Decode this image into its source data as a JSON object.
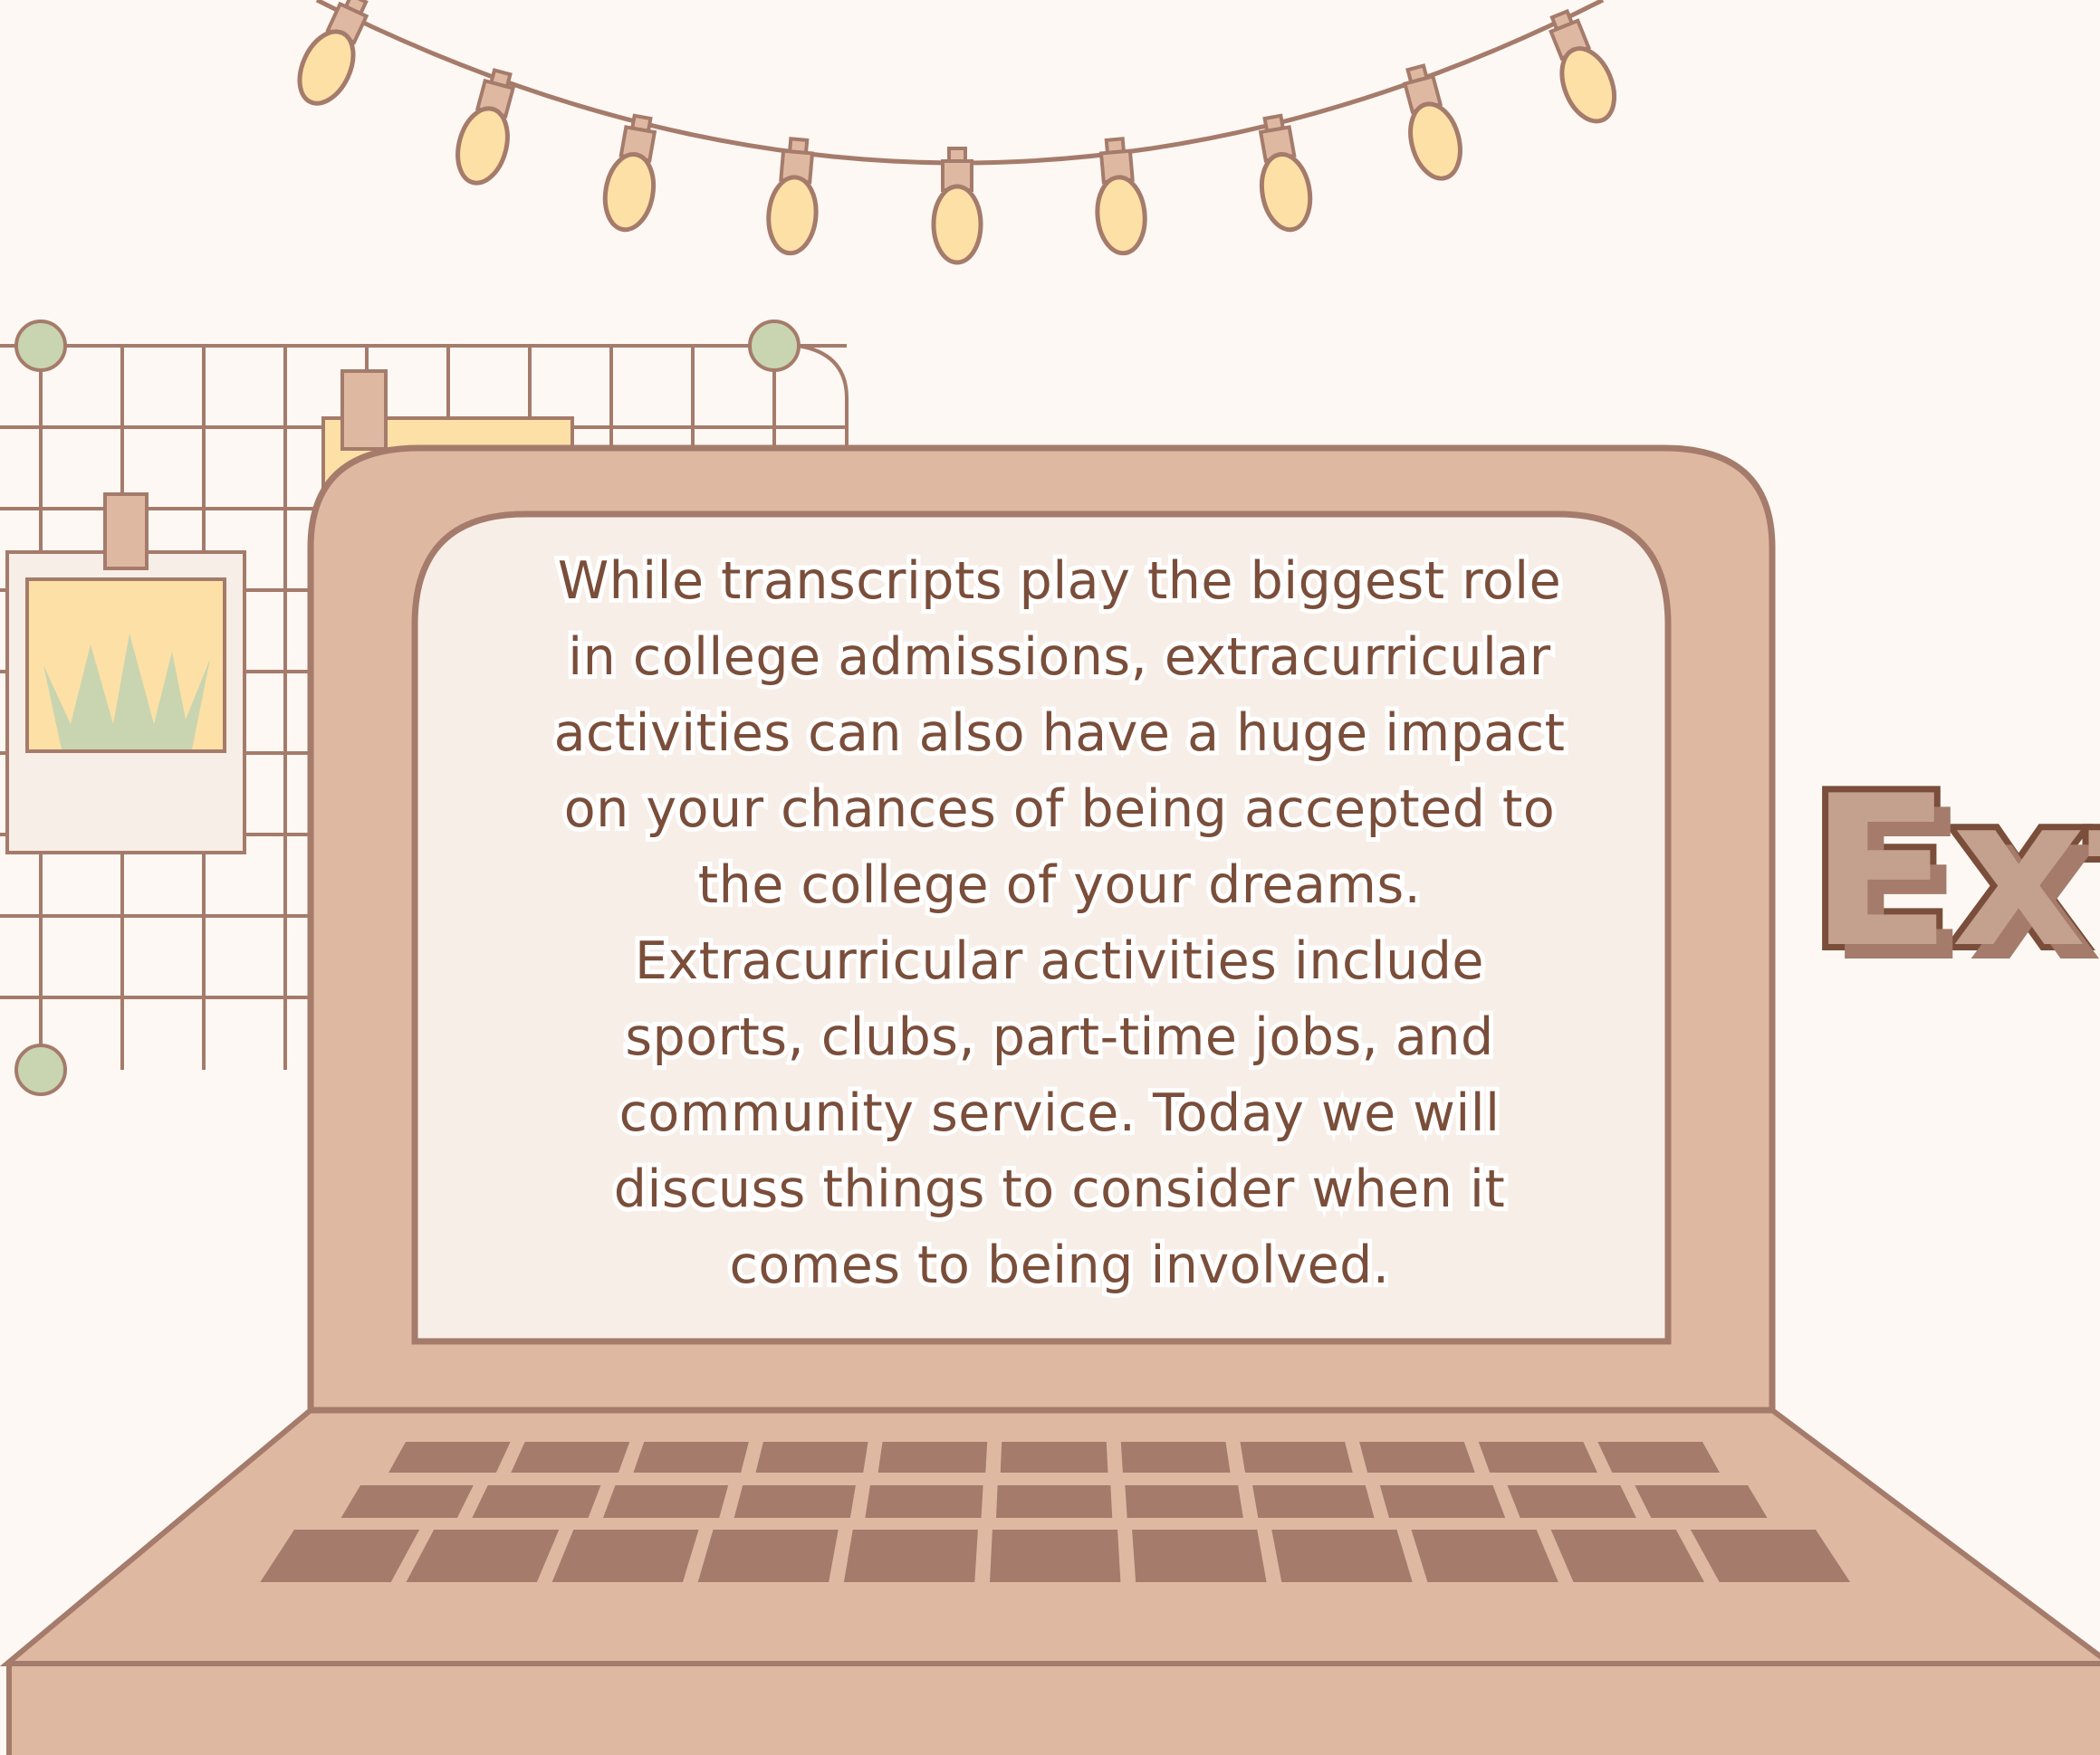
{
  "screen": {
    "lines": [
      "While transcripts play the biggest role",
      "in college admissions, extracurricular",
      "activities can also have a huge impact",
      "on your chances of being accepted to",
      "the college of your dreams.",
      "Extracurricular activities include",
      "sports, clubs, part-time jobs, and",
      "community service. Today we will",
      "discuss things to consider when it",
      "comes to being involved."
    ]
  },
  "side_title": "Ext",
  "colors": {
    "background": "#fdf8f3",
    "outline": "#a57b6b",
    "laptop_body": "#dfb8a2",
    "screen_fill": "#f7eee7",
    "keys": "#a57b6b",
    "bulb": "#fde0a6",
    "socket": "#dfb8a2",
    "grid_dot": "#c8d5b0",
    "note_yellow": "#fde0a6",
    "plant": "#c8d5b0",
    "text": "#7a4e3a"
  },
  "icons": [
    "light-bulb-icon",
    "plant-icon"
  ]
}
